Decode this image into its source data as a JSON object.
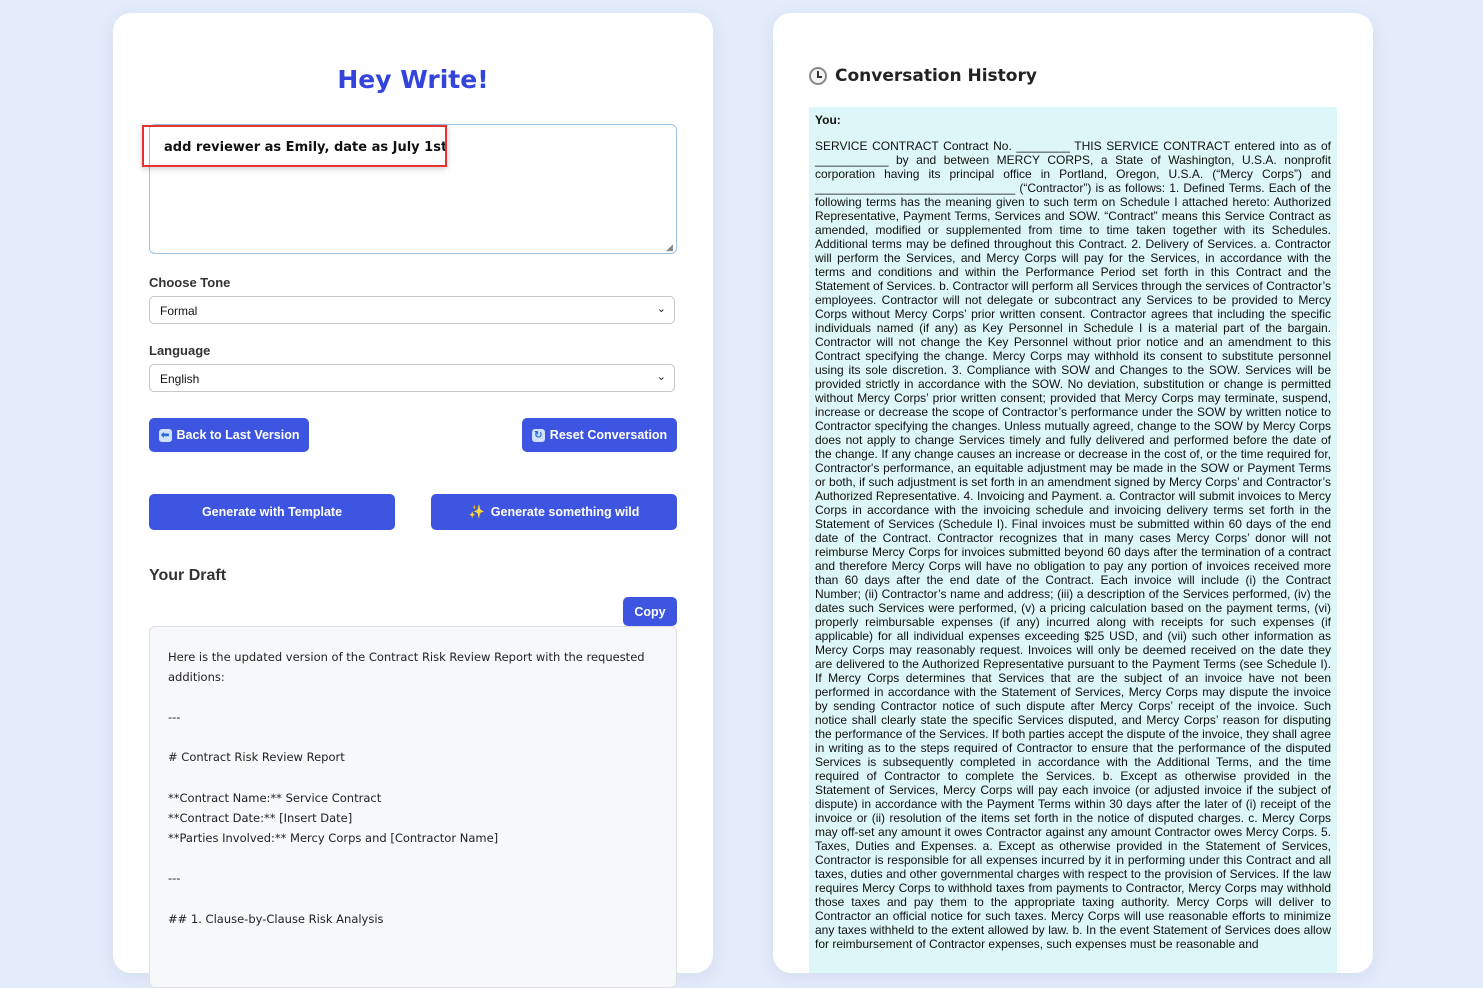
{
  "editor": {
    "title": "Hey Write!",
    "prompt_value": "add reviewer as Emily, date as July 1st",
    "tone_label": "Choose Tone",
    "tone_value": "Formal",
    "language_label": "Language",
    "language_value": "English",
    "back_button": "Back to Last Version",
    "reset_button": "Reset Conversation",
    "template_button": "Generate with Template",
    "wild_button": "Generate something wild",
    "draft_title": "Your Draft",
    "copy_button": "Copy",
    "draft_lines": [
      "Here is the updated version of the Contract Risk Review Report with the requested",
      "additions:",
      "---",
      "# Contract Risk Review Report",
      "**Contract Name:** Service Contract",
      "**Contract Date:** [Insert Date]",
      "**Parties Involved:** Mercy Corps and [Contractor Name]",
      "---",
      "## 1. Clause-by-Clause Risk Analysis"
    ]
  },
  "history": {
    "title": "Conversation History",
    "speaker": "You:",
    "message": "SERVICE CONTRACT Contract No. ________ THIS SERVICE CONTRACT entered into as of ___________ by and between MERCY CORPS, a State of Washington, U.S.A. nonprofit corporation having its principal office in Portland, Oregon, U.S.A. (“Mercy Corps”) and ______________________________ (“Contractor”) is as follows: 1. Defined Terms. Each of the following terms has the meaning given to such term on Schedule I attached hereto: Authorized Representative, Payment Terms, Services and SOW. “Contract” means this Service Contract as amended, modified or supplemented from time to time taken together with its Schedules. Additional terms may be defined throughout this Contract. 2. Delivery of Services. a. Contractor will perform the Services, and Mercy Corps will pay for the Services, in accordance with the terms and conditions and within the Performance Period set forth in this Contract and the Statement of Services. b. Contractor will perform all Services through the services of Contractor’s employees. Contractor will not delegate or subcontract any Services to be provided to Mercy Corps without Mercy Corps’ prior written consent. Contractor agrees that including the specific individuals named (if any) as Key Personnel in Schedule I is a material part of the bargain. Contractor will not change the Key Personnel without prior notice and an amendment to this Contract specifying the change. Mercy Corps may withhold its consent to substitute personnel using its sole discretion. 3. Compliance with SOW and Changes to the SOW. Services will be provided strictly in accordance with the SOW. No deviation, substitution or change is permitted without Mercy Corps’ prior written consent; provided that Mercy Corps may terminate, suspend, increase or decrease the scope of Contractor’s performance under the SOW by written notice to Contractor specifying the changes. Unless mutually agreed, change to the SOW by Mercy Corps does not apply to change Services timely and fully delivered and performed before the date of the change. If any change causes an increase or decrease in the cost of, or the time required for, Contractor's performance, an equitable adjustment may be made in the SOW or Payment Terms or both, if such adjustment is set forth in an amendment signed by Mercy Corps’ and Contractor’s Authorized Representative. 4. Invoicing and Payment. a. Contractor will submit invoices to Mercy Corps in accordance with the invoicing schedule and invoicing delivery terms set forth in the Statement of Services (Schedule I). Final invoices must be submitted within 60 days of the end date of the Contract. Contractor recognizes that in many cases Mercy Corps’ donor will not reimburse Mercy Corps for invoices submitted beyond 60 days after the termination of a contract and therefore Mercy Corps will have no obligation to pay any portion of invoices received more than 60 days after the end date of the Contract. Each invoice will include (i) the Contract Number; (ii) Contractor’s name and address; (iii) a description of the Services performed, (iv) the dates such Services were performed, (v) a pricing calculation based on the payment terms, (vi) properly reimbursable expenses (if any) incurred along with receipts for such expenses (if applicable) for all individual expenses exceeding $25 USD, and (vii) such other information as Mercy Corps may reasonably request. Invoices will only be deemed received on the date they are delivered to the Authorized Representative pursuant to the Payment Terms (see Schedule I). If Mercy Corps determines that Services that are the subject of an invoice have not been performed in accordance with the Statement of Services, Mercy Corps may dispute the invoice by sending Contractor notice of such dispute after Mercy Corps’ receipt of the invoice. Such notice shall clearly state the specific Services disputed, and Mercy Corps’ reason for disputing the performance of the Services. If both parties accept the dispute of the invoice, they shall agree in writing as to the steps required of Contractor to ensure that the performance of the disputed Services is subsequently completed in accordance with the Additional Terms, and the time required of Contractor to complete the Services. b. Except as otherwise provided in the Statement of Services, Mercy Corps will pay each invoice (or adjusted invoice if the subject of dispute) in accordance with the Payment Terms within 30 days after the later of (i) receipt of the invoice or (ii) resolution of the items set forth in the notice of disputed charges. c. Mercy Corps may off-set any amount it owes Contractor against any amount Contractor owes Mercy Corps. 5. Taxes, Duties and Expenses. a. Except as otherwise provided in the Statement of Services, Contractor is responsible for all expenses incurred by it in performing under this Contract and all taxes, duties and other governmental charges with respect to the provision of Services. If the law requires Mercy Corps to withhold taxes from payments to Contractor, Mercy Corps may withhold those taxes and pay them to the appropriate taxing authority. Mercy Corps will deliver to Contractor an official notice for such taxes. Mercy Corps will use reasonable efforts to minimize any taxes withheld to the extent allowed by law. b. In the event Statement of Services does allow for reimbursement of Contractor expenses, such expenses must be reasonable and"
  },
  "icons": {
    "back": "back-arrow-icon",
    "reset": "refresh-icon",
    "wild": "sparkles-icon",
    "clock": "clock-icon"
  },
  "colors": {
    "accent": "#3d55e0",
    "title": "#3344dd",
    "highlight": "#e8322f",
    "history_bg": "#ddf6f7",
    "page_bg": "#e4ecfb"
  }
}
